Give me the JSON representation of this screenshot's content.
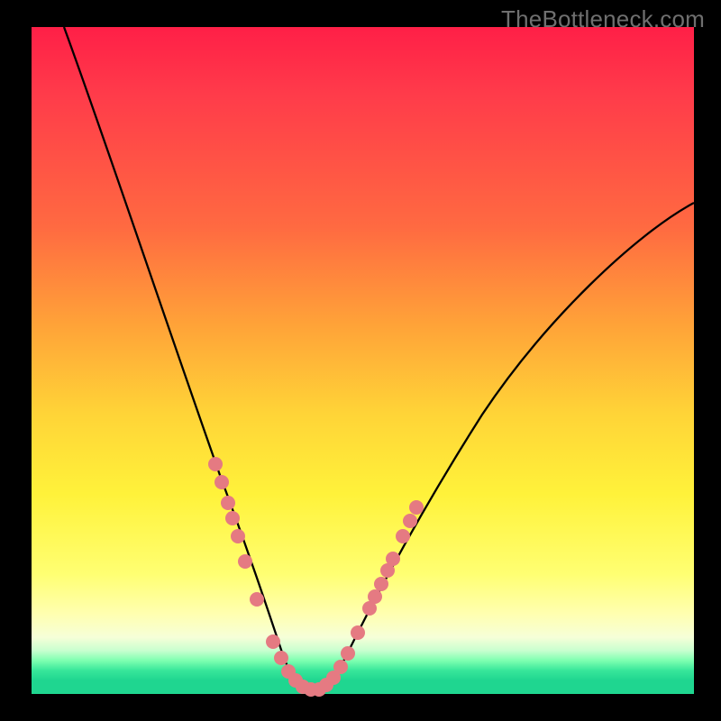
{
  "watermark": "TheBottleneck.com",
  "colors": {
    "gradient_top": "#ff1f47",
    "gradient_mid": "#ffd437",
    "gradient_bottom": "#1fd690",
    "curve": "#000000",
    "dots": "#e57a82",
    "frame": "#000000"
  },
  "chart_data": {
    "type": "line",
    "title": "",
    "xlabel": "",
    "ylabel": "",
    "xlim": [
      0,
      100
    ],
    "ylim": [
      0,
      100
    ],
    "grid": false,
    "legend": false,
    "series": [
      {
        "name": "bottleneck-curve",
        "x": [
          5,
          10,
          15,
          20,
          25,
          28,
          30,
          32,
          34,
          36,
          38,
          40,
          42,
          44,
          46,
          50,
          55,
          60,
          65,
          70,
          75,
          80,
          85,
          90,
          95,
          100
        ],
        "y": [
          100,
          88,
          73,
          57,
          41,
          32,
          26,
          20,
          14,
          8,
          4,
          2,
          2,
          4,
          8,
          16,
          25,
          33,
          40,
          46,
          52,
          57,
          62,
          66,
          70,
          74
        ]
      }
    ],
    "highlight_points": {
      "name": "sample-markers",
      "x": [
        27,
        28,
        29,
        29.5,
        30,
        31,
        33,
        36,
        37,
        38,
        39,
        40,
        41,
        42,
        43,
        44,
        45,
        46,
        48,
        50,
        51,
        51.5,
        52,
        53
      ],
      "y": [
        35,
        32,
        29,
        27,
        26,
        22,
        15,
        8,
        6,
        4,
        3,
        2,
        2,
        2,
        3,
        4,
        6,
        8,
        12,
        16,
        18,
        19,
        21,
        23
      ]
    }
  }
}
